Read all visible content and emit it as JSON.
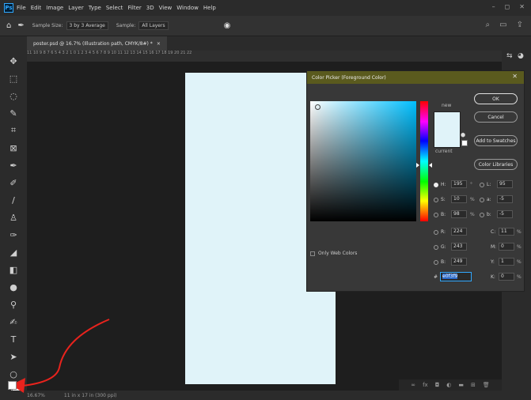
{
  "menubar": {
    "logo": "Ps",
    "items": [
      "File",
      "Edit",
      "Image",
      "Layer",
      "Type",
      "Select",
      "Filter",
      "3D",
      "View",
      "Window",
      "Help"
    ],
    "window_controls": [
      "–",
      "◻",
      "✕"
    ]
  },
  "options": {
    "sample_size_label": "Sample Size:",
    "sample_size_value": "3 by 3 Average",
    "sample_label": "Sample:",
    "sample_value": "All Layers"
  },
  "tab": {
    "title": "poster.psd @ 16.7% (Illustration path, CMYK/8#) *"
  },
  "ruler": {
    "ticks": "11  10  9  8  7  6  5  4  3  2  1  0  1  2  3  4  5  6  7  8  9  10  11  12  13  14  15  16  17  18  19  20  21  22"
  },
  "status": {
    "zoom": "16.67%",
    "doc_size": "11 in x 17 in (300 ppi)"
  },
  "dialog": {
    "title": "Color Picker (Foreground Color)",
    "close": "✕",
    "new_label": "new",
    "current_label": "current",
    "buttons": {
      "ok": "OK",
      "cancel": "Cancel",
      "add": "Add to Swatches",
      "libraries": "Color Libraries"
    },
    "hsb": {
      "h": {
        "label": "H:",
        "value": "195",
        "unit": "°"
      },
      "s": {
        "label": "S:",
        "value": "10",
        "unit": "%"
      },
      "b": {
        "label": "B:",
        "value": "98",
        "unit": "%"
      }
    },
    "rgb": {
      "r": {
        "label": "R:",
        "value": "224"
      },
      "g": {
        "label": "G:",
        "value": "243"
      },
      "b": {
        "label": "B:",
        "value": "249"
      }
    },
    "lab": {
      "l": {
        "label": "L:",
        "value": "95"
      },
      "a": {
        "label": "a:",
        "value": "-5"
      },
      "b": {
        "label": "b:",
        "value": "-5"
      }
    },
    "cmyk": {
      "c": {
        "label": "C:",
        "value": "11",
        "unit": "%"
      },
      "m": {
        "label": "M:",
        "value": "0",
        "unit": "%"
      },
      "y": {
        "label": "Y:",
        "value": "1",
        "unit": "%"
      },
      "k": {
        "label": "K:",
        "value": "0",
        "unit": "%"
      }
    },
    "web_colors_label": "Only Web Colors",
    "hash": "#",
    "hex": "e0f3f9"
  },
  "colors": {
    "document": "#e0f3f9",
    "dialog_title": "#5a5a1e",
    "annotation": "#e8231d"
  }
}
